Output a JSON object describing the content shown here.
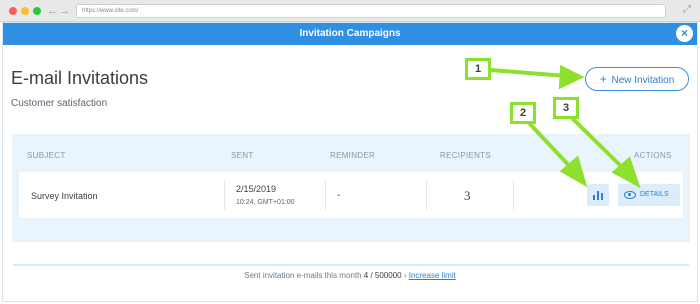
{
  "browser": {
    "url": "https://www.site.com/"
  },
  "modal": {
    "title": "Invitation Campaigns",
    "close_label": "×"
  },
  "page": {
    "title": "E-mail Invitations",
    "subtitle": "Customer satisfaction",
    "new_button_label": "New Invitation"
  },
  "table": {
    "headers": {
      "subject": "SUBJECT",
      "sent": "SENT",
      "reminder": "REMINDER",
      "recipients": "RECIPIENTS",
      "actions": "ACTIONS"
    },
    "rows": [
      {
        "subject": "Survey Invitation",
        "sent_date": "2/15/2019",
        "sent_time": "10:24, GMT+01:00",
        "reminder": "-",
        "recipients": "3",
        "details_label": "DETAILS"
      }
    ]
  },
  "footer": {
    "prefix": "Sent invitation e-mails this month",
    "count": "4 / 500000",
    "separator": "›",
    "link": "Increase limit"
  },
  "callouts": [
    "1",
    "2",
    "3"
  ],
  "colors": {
    "header_blue": "#2f8fe2",
    "accent_blue": "#2f7fd0",
    "panel_bg": "#eaf4fc",
    "callout_green": "#8de02e"
  },
  "icons": [
    "search-icon",
    "bar-chart-icon",
    "eye-icon",
    "close-icon",
    "plus-icon"
  ]
}
